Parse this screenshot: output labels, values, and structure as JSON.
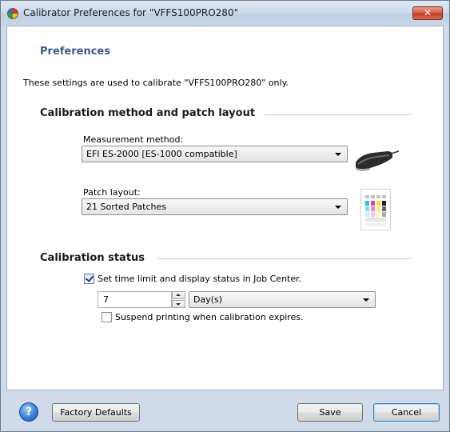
{
  "window": {
    "title": "Calibrator Preferences for \"VFFS100PRO280\"",
    "close_glyph": "✕"
  },
  "heading": "Preferences",
  "intro": "These settings are used to calibrate \"VFFS100PRO280\" only.",
  "calibration_method": {
    "section_title": "Calibration method and patch layout",
    "measurement_label": "Measurement method:",
    "measurement_value": "EFI ES-2000 [ES-1000 compatible]",
    "measurement_icon": "spectrophotometer-icon",
    "patch_label": "Patch layout:",
    "patch_value": "21 Sorted Patches",
    "patch_icon": "patch-layout-icon"
  },
  "calibration_status": {
    "section_title": "Calibration status",
    "time_limit_checkbox": {
      "label": "Set time limit and display status in Job Center.",
      "checked": true
    },
    "time_value": "7",
    "time_unit": "Day(s)",
    "suspend_checkbox": {
      "label": "Suspend printing when calibration expires.",
      "checked": false
    }
  },
  "footer": {
    "help_glyph": "?",
    "factory_defaults_label": "Factory Defaults",
    "save_label": "Save",
    "cancel_label": "Cancel"
  },
  "colors": {
    "heading": "#3a5a8c",
    "frame": "#cfdbe9",
    "close_button": "#c23a1e"
  }
}
